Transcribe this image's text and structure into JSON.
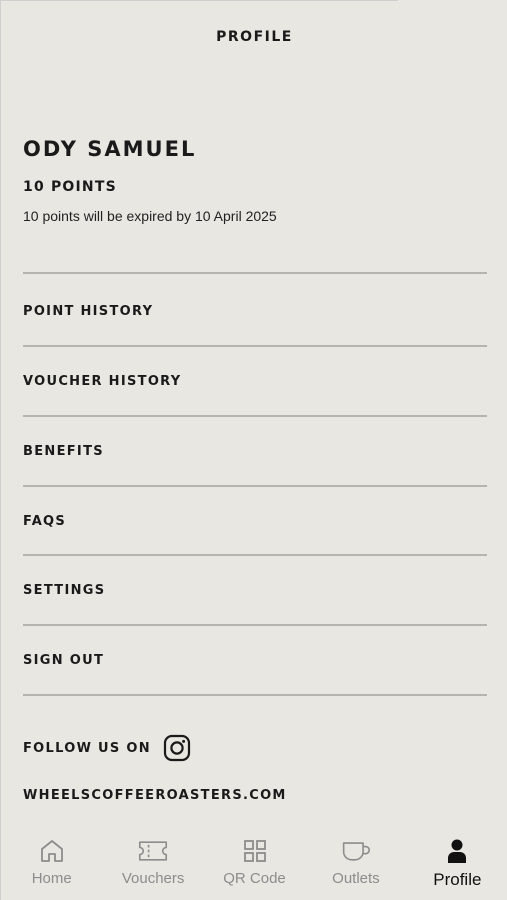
{
  "header": {
    "title": "PROFILE"
  },
  "profile": {
    "name": "ODY SAMUEL",
    "points": "10 POINTS",
    "expiry_note": "10 points will be expired by 10 April 2025"
  },
  "menu": [
    {
      "label": "POINT HISTORY"
    },
    {
      "label": "VOUCHER HISTORY"
    },
    {
      "label": "BENEFITS"
    },
    {
      "label": "FAQS"
    },
    {
      "label": "SETTINGS"
    },
    {
      "label": "SIGN OUT"
    }
  ],
  "social": {
    "follow_label": "FOLLOW US ON",
    "icon": "instagram-icon",
    "website": "WHEELSCOFFEEROASTERS.COM"
  },
  "tabs": [
    {
      "label": "Home",
      "icon": "home-icon",
      "active": false
    },
    {
      "label": "Vouchers",
      "icon": "ticket-icon",
      "active": false
    },
    {
      "label": "QR Code",
      "icon": "grid-icon",
      "active": false
    },
    {
      "label": "Outlets",
      "icon": "cup-icon",
      "active": false
    },
    {
      "label": "Profile",
      "icon": "person-icon",
      "active": true
    }
  ],
  "colors": {
    "background": "#e8e7e1",
    "text": "#1a1a1a",
    "divider": "#b4b4b1",
    "tab_inactive": "#8c8c8c",
    "tab_active": "#111111"
  }
}
